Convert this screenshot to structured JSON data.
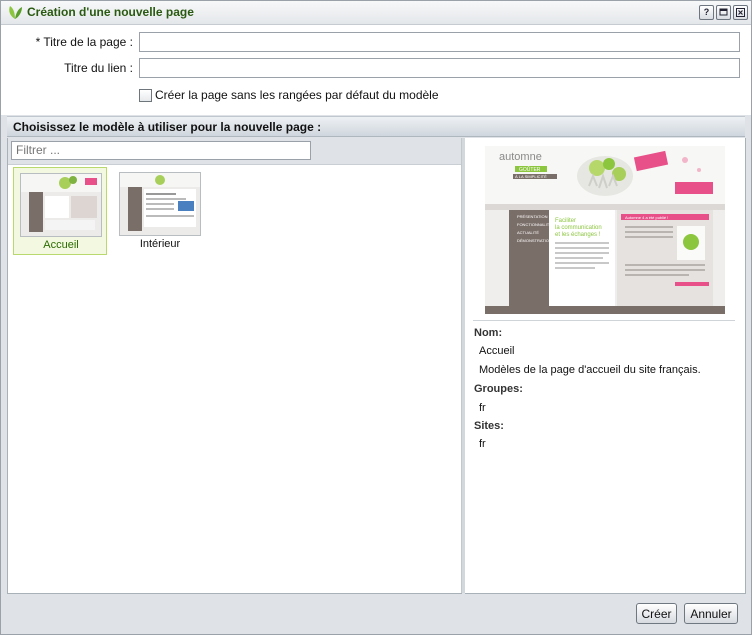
{
  "window": {
    "title": "Création d'une nouvelle page",
    "buttons": {
      "help": "?",
      "maximize": "□",
      "close": "✕"
    }
  },
  "form": {
    "page_title_label": "* Titre de la page :",
    "page_title_value": "",
    "link_title_label": "Titre du lien :",
    "link_title_value": "",
    "no_default_rows_label": "Créer la page sans les rangées par défaut du modèle",
    "no_default_rows_checked": false
  },
  "templates": {
    "header": "Choisissez le modèle à utiliser pour la nouvelle page :",
    "filter_placeholder": "Filtrer ...",
    "items": [
      {
        "name": "Accueil",
        "selected": true
      },
      {
        "name": "Intérieur",
        "selected": false
      }
    ]
  },
  "details": {
    "preview": {
      "brand": "automne",
      "slogan_badge": "GOÛTER",
      "slogan": "À LA SIMPLICITÉ",
      "headline": "Faciliter la communication et les échanges !",
      "nav": [
        "PRÉSENTATION",
        "FONCTIONNALITÉS",
        "ACTUALITÉ",
        "DÉMONSTRATION"
      ],
      "sidebar_title": "Automne 4 a été publié !"
    },
    "name_label": "Nom:",
    "name_value": "Accueil",
    "description": "Modèles de la page d'accueil du site français.",
    "groups_label": "Groupes:",
    "groups_value": "fr",
    "sites_label": "Sites:",
    "sites_value": "fr"
  },
  "footer": {
    "create_label": "Créer",
    "cancel_label": "Annuler"
  },
  "colors": {
    "title_text": "#2a5a11",
    "accent_green": "#8cc63f",
    "accent_pink": "#e8508a",
    "preview_brown": "#7a6e68"
  }
}
